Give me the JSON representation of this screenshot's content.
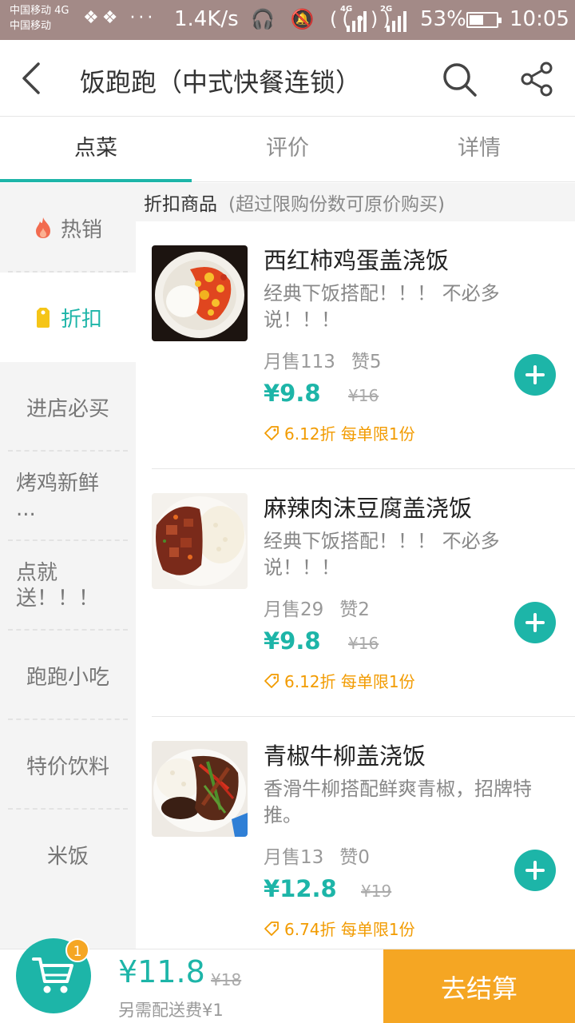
{
  "status_bar": {
    "carrier_top": "中国移动 4G",
    "carrier_bottom": "中国移动",
    "notif_icons": "❖❖ ···",
    "speed": "1.4K/s",
    "mid_icons": "🎧 🔕 ((•))",
    "sig1_label": "4G",
    "sig2_label": "2G",
    "battery_pct": "53%",
    "battery_level": 0.53,
    "time": "10:05"
  },
  "header": {
    "title": "饭跑跑（中式快餐连锁）"
  },
  "tabs": [
    {
      "label": "点菜",
      "active": true
    },
    {
      "label": "评价",
      "active": false
    },
    {
      "label": "详情",
      "active": false
    }
  ],
  "sidebar": {
    "items": [
      {
        "label": "热销",
        "icon": "flame-icon"
      },
      {
        "label": "折扣",
        "icon": "tag-icon",
        "active": true
      },
      {
        "label": "进店必买"
      },
      {
        "label": "烤鸡新鲜",
        "label2": "..."
      },
      {
        "label": "点就",
        "label2": "送！！！"
      },
      {
        "label": "跑跑小吃"
      },
      {
        "label": "特价饮料"
      },
      {
        "label": "米饭"
      }
    ]
  },
  "section": {
    "title": "折扣商品",
    "note": "(超过限购份数可原价购买)"
  },
  "items": [
    {
      "name": "西红柿鸡蛋盖浇饭",
      "desc": "经典下饭搭配！！！ 不必多说！！！",
      "sales": "月售113",
      "likes": "赞5",
      "price": "¥9.8",
      "orig_price": "¥16",
      "promo": "6.12折 每单限1份"
    },
    {
      "name": "麻辣肉沫豆腐盖浇饭",
      "desc": "经典下饭搭配！！！ 不必多说！！！",
      "sales": "月售29",
      "likes": "赞2",
      "price": "¥9.8",
      "orig_price": "¥16",
      "promo": "6.12折 每单限1份"
    },
    {
      "name": "青椒牛柳盖浇饭",
      "desc": "香滑牛柳搭配鲜爽青椒，招牌特推。",
      "sales": "月售13",
      "likes": "赞0",
      "price": "¥12.8",
      "orig_price": "¥19",
      "promo": "6.74折 每单限1份"
    }
  ],
  "cart": {
    "badge": "1",
    "total": "¥11.8",
    "total_orig": "¥18",
    "delivery": "另需配送费¥1",
    "checkout": "去结算"
  },
  "colors": {
    "accent": "#1db5a8",
    "orange": "#f5a623",
    "status_bar": "#a38a87"
  }
}
